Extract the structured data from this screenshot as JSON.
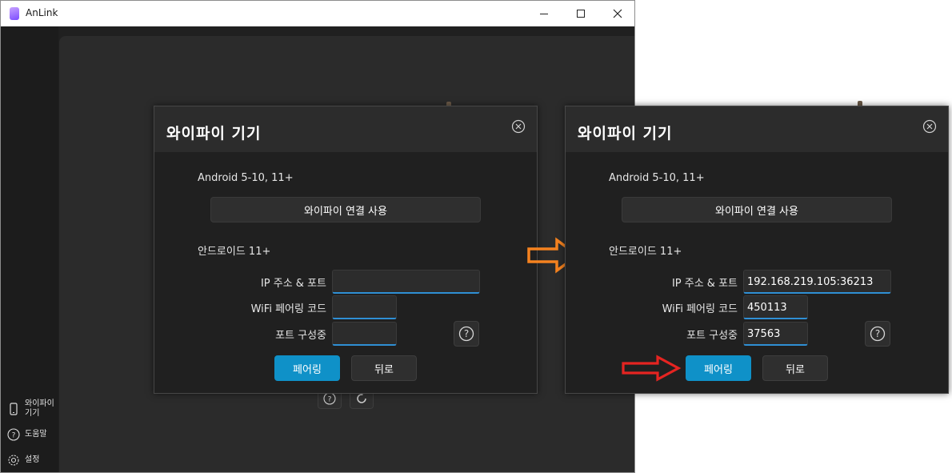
{
  "window": {
    "app_name": "AnLink",
    "controls": {
      "minimize": "–",
      "maximize": "□",
      "close": "✕"
    }
  },
  "sidebar": {
    "items": [
      {
        "label": "와이파이\n기기",
        "icon": "phone-icon"
      },
      {
        "label": "도움말",
        "icon": "help-circle-icon"
      },
      {
        "label": "설정",
        "icon": "gear-icon"
      }
    ]
  },
  "dialogs": [
    {
      "title": "와이파이 기기",
      "section_android": "Android 5-10, 11+",
      "wifi_button": "와이파이 연결 사용",
      "section_korean": "안드로이드 11+",
      "ip_label": "IP 주소 & 포트",
      "ip_value": "",
      "pairing_label": "WiFi 페어링 코드",
      "pairing_value": "",
      "port_label": "포트 구성중",
      "port_value": "",
      "pair_button": "페어링",
      "back_button": "뒤로"
    },
    {
      "title": "와이파이 기기",
      "section_android": "Android 5-10, 11+",
      "wifi_button": "와이파이 연결 사용",
      "section_korean": "안드로이드 11+",
      "ip_label": "IP 주소 & 포트",
      "ip_value": "192.168.219.105:36213",
      "pairing_label": "WiFi 페어링 코드",
      "pairing_value": "450113",
      "port_label": "포트 구성중",
      "port_value": "37563",
      "pair_button": "페어링",
      "back_button": "뒤로"
    }
  ],
  "annotations": {
    "orange_arrow_color": "#f5821f",
    "red_arrow_color": "#e52421"
  },
  "colors": {
    "accent": "#0f91c8",
    "focus_underline": "#2f8fd4",
    "dialog_bg": "#202020",
    "header_bg": "#2c2c2c"
  }
}
